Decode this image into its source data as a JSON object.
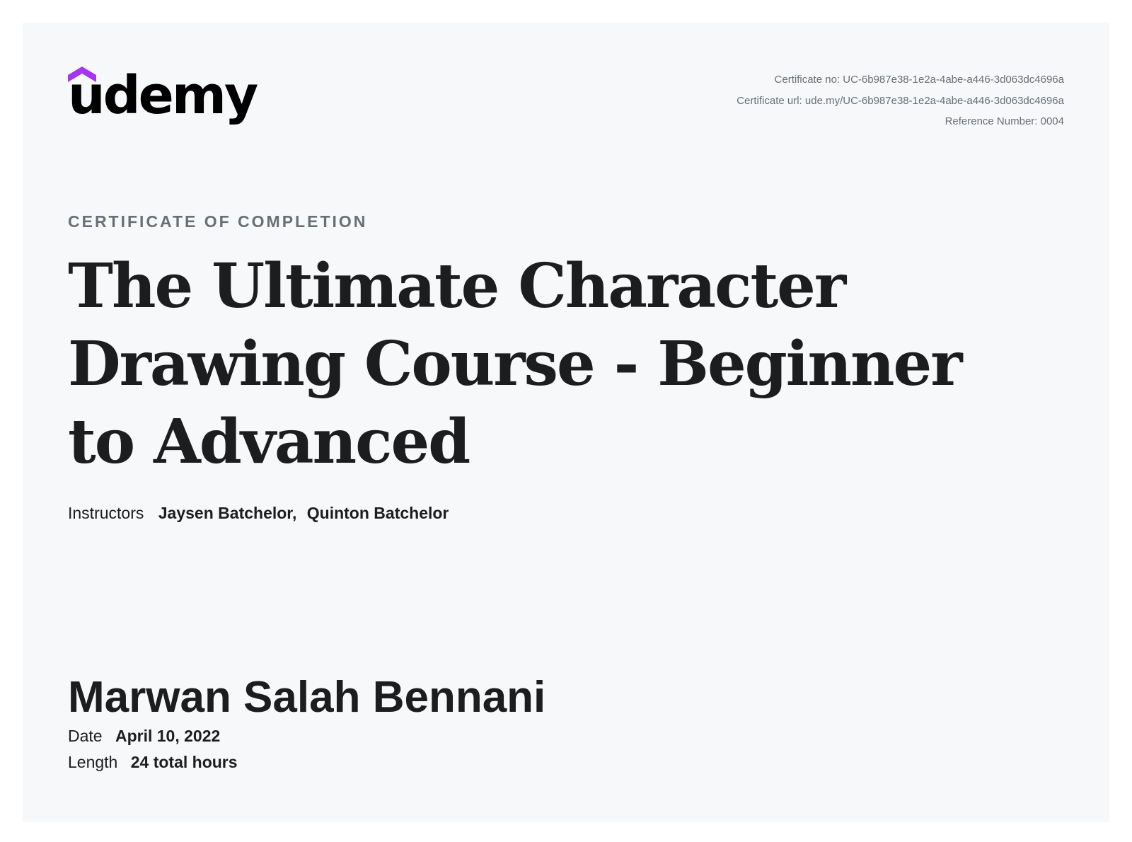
{
  "brand": {
    "name": "udemy",
    "accent": "#a435f0"
  },
  "meta": {
    "certificate_no": "Certificate no: UC-6b987e38-1e2a-4abe-a446-3d063dc4696a",
    "certificate_url": "Certificate url: ude.my/UC-6b987e38-1e2a-4abe-a446-3d063dc4696a",
    "reference": "Reference Number: 0004"
  },
  "label": "CERTIFICATE OF COMPLETION",
  "course_title": "The Ultimate Character Drawing Course - Beginner to Advanced",
  "instructors": {
    "label": "Instructors",
    "names": [
      "Jaysen Batchelor,",
      "Quinton Batchelor"
    ]
  },
  "recipient": "Marwan Salah Bennani",
  "date": {
    "label": "Date",
    "value": "April 10, 2022"
  },
  "length": {
    "label": "Length",
    "value": "24 total hours"
  }
}
